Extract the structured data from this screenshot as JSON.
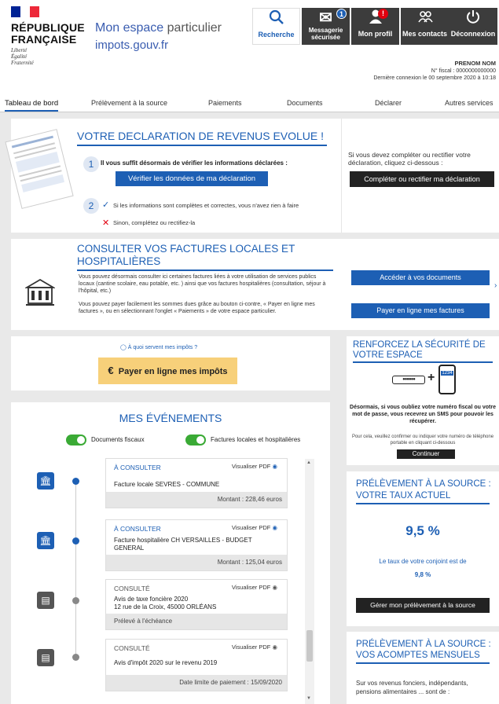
{
  "header": {
    "rf_line1": "RÉPUBLIQUE",
    "rf_line2": "FRANÇAISE",
    "motto": [
      "Liberté",
      "Égalité",
      "Fraternité"
    ],
    "espace_a": "Mon espace",
    "espace_b": "particulier",
    "site": "impots.gouv.fr",
    "buttons": [
      {
        "label": "Recherche",
        "icon": "search-icon"
      },
      {
        "label": "Messagerie sécurisée",
        "icon": "mail-icon",
        "badge": "1"
      },
      {
        "label": "Mon profil",
        "icon": "user-icon",
        "badge": "!"
      },
      {
        "label": "Mes contacts",
        "icon": "contacts-icon"
      },
      {
        "label": "Déconnexion",
        "icon": "power-icon"
      }
    ],
    "user_name": "PRENOM NOM",
    "fiscal": "N° fiscal : 0000000000000",
    "last_login": "Dernière connexion le 00 septembre 2020 à 10:18"
  },
  "nav": [
    "Tableau de bord",
    "Prélèvement à la source",
    "Paiements",
    "Documents",
    "Déclarer",
    "Autres services"
  ],
  "decl": {
    "title": "VOTRE DECLARATION DE REVENUS EVOLUE !",
    "step1_num": "1",
    "step1_text": "Il vous suffit désormais de vérifier les informations déclarées :",
    "verify_btn": "Vérifier les données de ma déclaration",
    "step2_num": "2",
    "yes_text": "Si les informations sont complètes et correctes, vous n'avez rien à faire",
    "no_text": "Sinon, complétez ou rectifiez-la",
    "side_text": "Si vous devez compléter ou rectifier votre déclaration, cliquez ci-dessous :",
    "side_btn": "Compléter ou rectifier ma déclaration"
  },
  "factures": {
    "title1": "CONSULTER VOS FACTURES LOCALES ET",
    "title2": "HOSPITALIÈRES",
    "p1": "Vous pouvez désormais consulter ici certaines factures liées à votre utilisation de services publics locaux (cantine scolaire, eau potable, etc. ) ainsi que vos factures hospitalières (consultation, séjour à l'hôpital, etc.)",
    "p2": "Vous pouvez payer facilement les sommes dues grâce au bouton ci-contre, « Payer en ligne mes factures », ou en sélectionnant l'onglet « Paiements » de votre espace particulier.",
    "btn1": "Accéder à vos documents",
    "btn2": "Payer en ligne mes factures"
  },
  "impots": {
    "link": "À quoi servent mes impôts ?",
    "pay_btn": "Payer en ligne mes impôts",
    "euro": "€"
  },
  "events": {
    "title": "MES ÉVÉNEMENTS",
    "toggle1": "Documents fiscaux",
    "toggle2": "Factures locales et hospitalières",
    "items": [
      {
        "status": "À CONSULTER",
        "pdf": "Visualiser PDF",
        "desc": "Facture locale SEVRES - COMMUNE",
        "footer": "Montant : 228,46 euros"
      },
      {
        "status": "À CONSULTER",
        "pdf": "Visualiser PDF",
        "desc": "Facture hospitalière CH VERSAILLES - BUDGET GENERAL",
        "footer": "Montant : 125,04 euros"
      },
      {
        "status": "CONSULTÉ",
        "pdf": "Visualiser PDF",
        "desc": "Avis de taxe foncière 2020\n12 rue de la Croix, 45000 ORLÉANS",
        "footer": "Prélevé à l'échéance"
      },
      {
        "status": "CONSULTÉ",
        "pdf": "Visualiser PDF",
        "desc": "Avis d'impôt 2020 sur le revenu 2019",
        "footer": "Date limite de paiement : 15/09/2020"
      }
    ]
  },
  "securite": {
    "title1": "RENFORCEZ LA SÉCURITÉ DE",
    "title2": "VOTRE ESPACE",
    "code": "1234",
    "p1": "Désormais, si vous oubliez votre numéro fiscal ou votre mot de passe, vous recevrez un SMS pour pouvoir les récupérer.",
    "p2": "Pour cela, veuillez confirmer ou indiquer votre numéro de téléphone portable en cliquant ci-dessous",
    "btn": "Continuer"
  },
  "taux": {
    "title1": "PRÉLÈVEMENT À LA SOURCE :",
    "title2": "VOTRE TAUX ACTUEL",
    "rate": "9,5 %",
    "conjoint_label": "Le taux de votre conjoint est de",
    "conjoint_rate": "9,8 %",
    "btn": "Gérer mon prélèvement à la source"
  },
  "acomptes": {
    "title1": "PRÉLÈVEMENT À LA SOURCE :",
    "title2": "VOS ACOMPTES MENSUELS",
    "text": "Sur vos revenus fonciers, indépendants, pensions alimentaires ... sont de :"
  },
  "colors": {
    "accent": "#1d5fb4",
    "dark": "#222222",
    "green": "#3aaa35",
    "badge_red": "#e1000f",
    "pay_yellow": "#f7d07a"
  }
}
